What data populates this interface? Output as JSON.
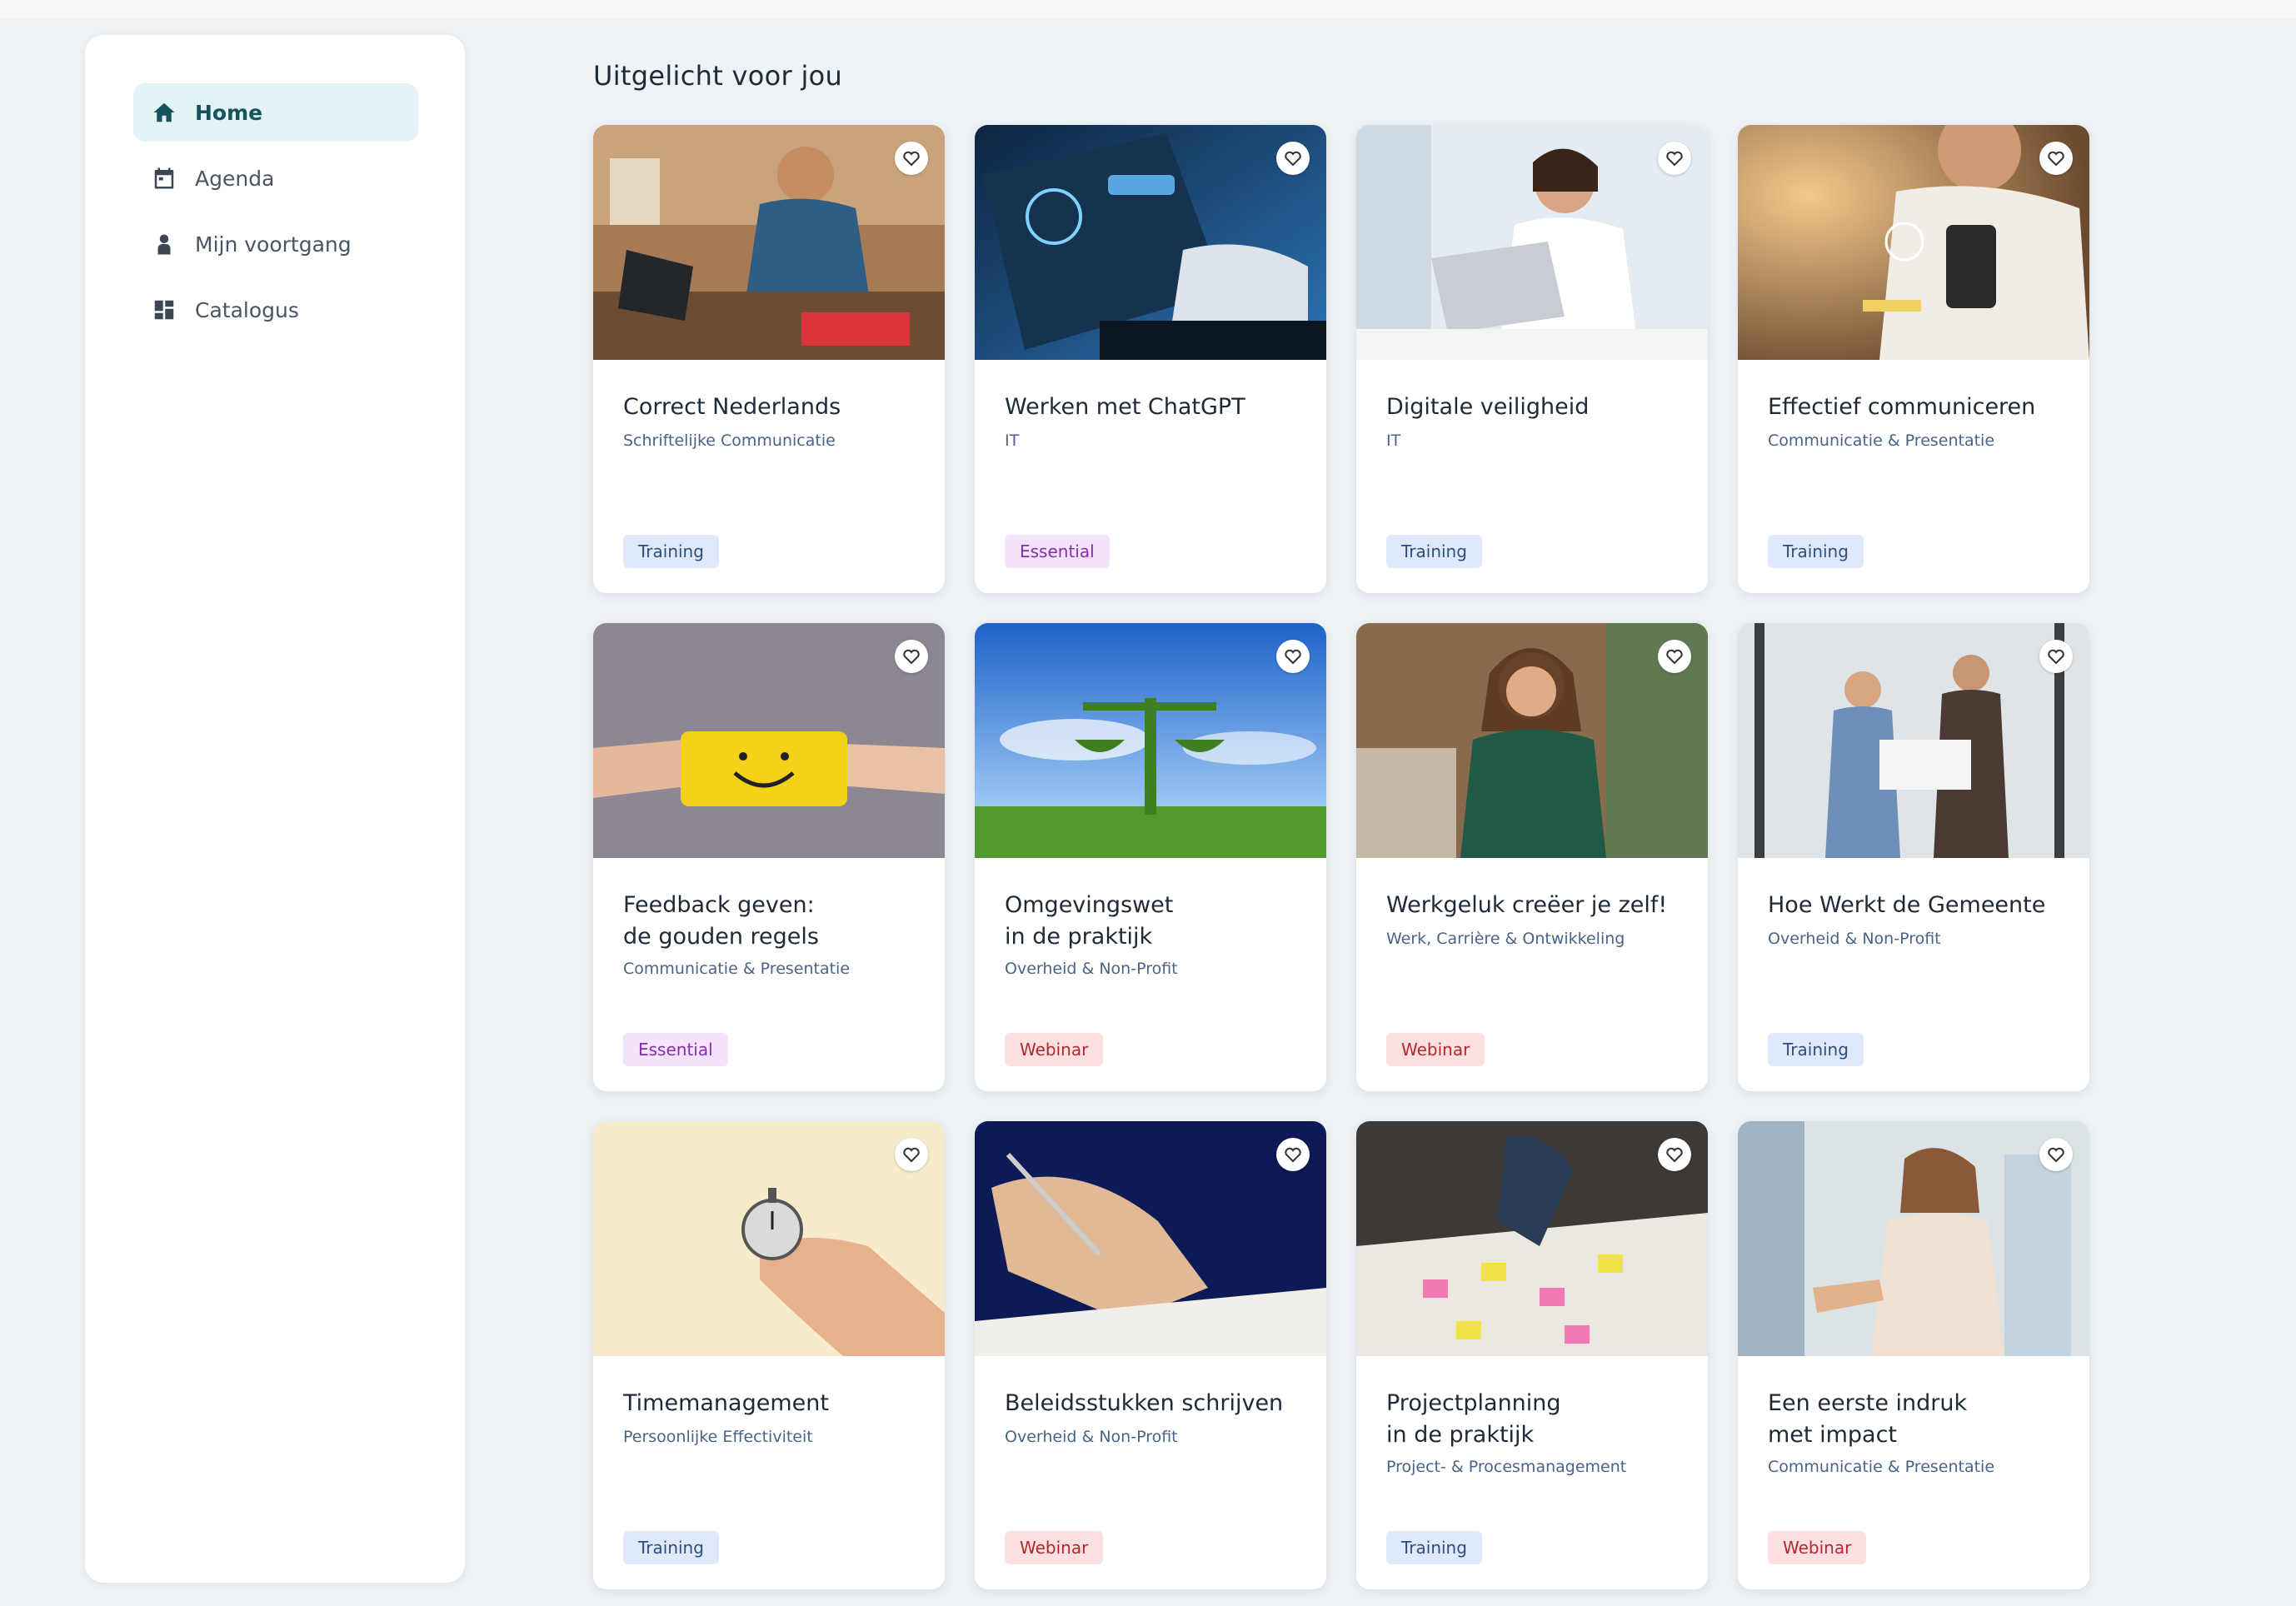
{
  "sidebar": {
    "items": [
      {
        "label": "Home",
        "icon": "home-icon",
        "active": true
      },
      {
        "label": "Agenda",
        "icon": "calendar-icon",
        "active": false
      },
      {
        "label": "Mijn voortgang",
        "icon": "person-icon",
        "active": false
      },
      {
        "label": "Catalogus",
        "icon": "grid-icon",
        "active": false
      }
    ]
  },
  "main": {
    "section_title": "Uitgelicht voor jou",
    "cards": [
      {
        "title": "Correct Nederlands",
        "category": "Schriftelijke Communicatie",
        "badge": "Training",
        "image": "man-at-laptop-photo"
      },
      {
        "title": "Werken met ChatGPT",
        "category": "IT",
        "badge": "Essential",
        "image": "chatgpt-laptop-photo"
      },
      {
        "title": "Digitale veiligheid",
        "category": "IT",
        "badge": "Training",
        "image": "woman-at-laptop-photo"
      },
      {
        "title": "Effectief communiceren",
        "category": "Communicatie & Presentatie",
        "badge": "Training",
        "image": "woman-with-phone-photo"
      },
      {
        "title": "Feedback geven:\nde gouden regels",
        "category": "Communicatie & Presentatie",
        "badge": "Essential",
        "image": "smiley-card-photo"
      },
      {
        "title": "Omgevingswet\nin de praktijk",
        "category": "Overheid & Non-Profit",
        "badge": "Webinar",
        "image": "green-scales-photo"
      },
      {
        "title": "Werkgeluk creëer je zelf!",
        "category": "Werk, Carrière & Ontwikkeling",
        "badge": "Webinar",
        "image": "smiling-woman-photo"
      },
      {
        "title": "Hoe Werkt de Gemeente",
        "category": "Overheid & Non-Profit",
        "badge": "Training",
        "image": "office-people-photo"
      },
      {
        "title": "Timemanagement",
        "category": "Persoonlijke Effectiviteit",
        "badge": "Training",
        "image": "stopwatch-photo"
      },
      {
        "title": "Beleidsstukken schrijven",
        "category": "Overheid & Non-Profit",
        "badge": "Webinar",
        "image": "writing-hand-photo"
      },
      {
        "title": "Projectplanning\nin de praktijk",
        "category": "Project- & Procesmanagement",
        "badge": "Training",
        "image": "planning-table-photo"
      },
      {
        "title": "Een eerste indruk\nmet impact",
        "category": "Communicatie & Presentatie",
        "badge": "Webinar",
        "image": "handshake-photo"
      }
    ]
  },
  "colors": {
    "accent": "#16535a",
    "active_bg": "#e4f3f7",
    "training_bg": "#dfe9fb",
    "essential_bg": "#f3e3fb",
    "webinar_bg": "#fbe0e2"
  }
}
